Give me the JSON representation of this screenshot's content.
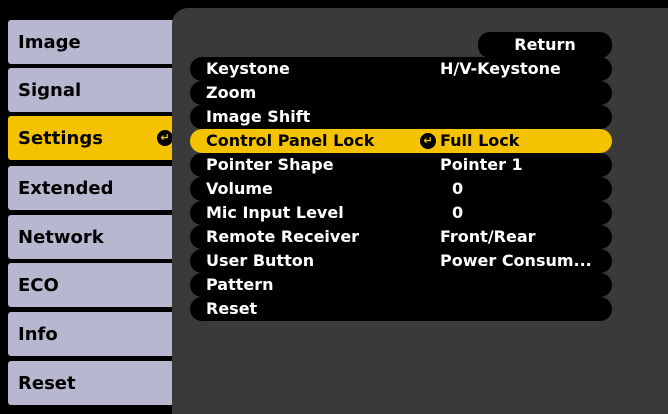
{
  "sidebar": {
    "items": [
      {
        "label": "Image"
      },
      {
        "label": "Signal"
      },
      {
        "label": "Settings",
        "enter_icon": "↵"
      },
      {
        "label": "Extended"
      },
      {
        "label": "Network"
      },
      {
        "label": "ECO"
      },
      {
        "label": "Info"
      },
      {
        "label": "Reset"
      }
    ],
    "active_index": 2
  },
  "panel": {
    "return_label": "Return",
    "selected_enter_icon": "↵",
    "rows": [
      {
        "label": "Keystone",
        "value": "H/V-Keystone"
      },
      {
        "label": "Zoom",
        "value": ""
      },
      {
        "label": "Image Shift",
        "value": ""
      },
      {
        "label": "Control Panel Lock",
        "value": "Full Lock"
      },
      {
        "label": "Pointer Shape",
        "value": "Pointer 1"
      },
      {
        "label": "Volume",
        "value": "0"
      },
      {
        "label": "Mic Input Level",
        "value": "0"
      },
      {
        "label": "Remote Receiver",
        "value": "Front/Rear"
      },
      {
        "label": "User Button",
        "value": "Power Consum..."
      },
      {
        "label": "Pattern",
        "value": ""
      },
      {
        "label": "Reset",
        "value": ""
      }
    ],
    "selected_index": 3
  },
  "colors": {
    "accent": "#f5c200",
    "tab": "#b7b8d0",
    "panel": "#3a3a3a",
    "row": "#000000"
  }
}
